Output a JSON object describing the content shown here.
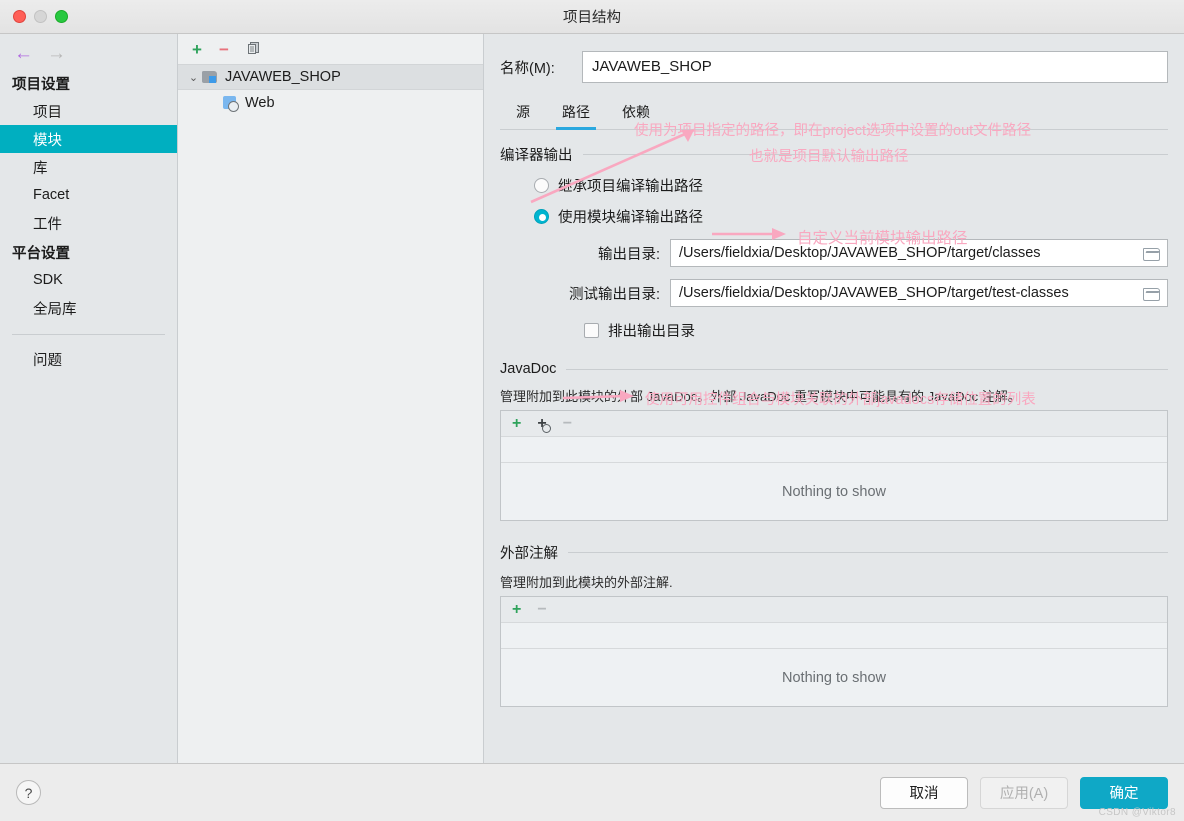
{
  "window": {
    "title": "项目结构",
    "traffic": {
      "close": "close-button",
      "minimize": "minimize-button",
      "zoom": "zoom-button"
    }
  },
  "sidebar": {
    "nav": {
      "back": "←",
      "forward": "→"
    },
    "groups": [
      {
        "title": "项目设置",
        "items": [
          {
            "label": "项目",
            "selected": false
          },
          {
            "label": "模块",
            "selected": true
          },
          {
            "label": "库",
            "selected": false
          },
          {
            "label": "Facet",
            "selected": false
          },
          {
            "label": "工件",
            "selected": false
          }
        ]
      },
      {
        "title": "平台设置",
        "items": [
          {
            "label": "SDK",
            "selected": false
          },
          {
            "label": "全局库",
            "selected": false
          }
        ]
      }
    ],
    "problems": {
      "label": "问题"
    },
    "accent": "#00afc0"
  },
  "tree": {
    "toolbar": {
      "add": "+",
      "remove": "−",
      "copy": "copy-icon"
    },
    "nodes": [
      {
        "label": "JAVAWEB_SHOP",
        "icon": "folder-module-icon",
        "expanded": true,
        "selected": true,
        "chevron": "⌄"
      },
      {
        "label": "Web",
        "icon": "web-facet-icon",
        "expanded": false,
        "selected": false
      }
    ]
  },
  "main": {
    "name_field": {
      "label": "名称(M):",
      "value": "JAVAWEB_SHOP"
    },
    "tabs": [
      {
        "label": "源",
        "active": false
      },
      {
        "label": "路径",
        "active": true
      },
      {
        "label": "依赖",
        "active": false
      }
    ],
    "compiler_output": {
      "title": "编译器输出",
      "radios": [
        {
          "label": "继承项目编译输出路径",
          "checked": false
        },
        {
          "label": "使用模块编译输出路径",
          "checked": true
        }
      ],
      "fields": [
        {
          "label": "输出目录:",
          "value": "/Users/fieldxia/Desktop/JAVAWEB_SHOP/target/classes",
          "browse": "browse-folder-icon"
        },
        {
          "label": "测试输出目录:",
          "value": "/Users/fieldxia/Desktop/JAVAWEB_SHOP/target/test-classes",
          "browse": "browse-folder-icon"
        }
      ],
      "checkbox": {
        "label": "排出输出目录",
        "checked": false
      }
    },
    "javadoc": {
      "title": "JavaDoc",
      "description": "管理附加到此模块的外部 JavaDoc。外部 JavaDoc 重写模块中可能具有的 JavaDoc 注解。",
      "toolbar": {
        "add": "+",
        "add_url": "+",
        "remove": "−"
      },
      "empty": "Nothing to show"
    },
    "external_annotations": {
      "title": "外部注解",
      "description": "管理附加到此模块的外部注解.",
      "toolbar": {
        "add": "+",
        "remove": "−"
      },
      "empty": "Nothing to show"
    }
  },
  "annotations": {
    "color": "#f9a8c0",
    "notes": [
      {
        "id": "note-inherit-path-line1",
        "text": "使用为项目指定的路径，即在project选项中设置的out文件路径"
      },
      {
        "id": "note-inherit-path-line2",
        "text": "也就是项目默认输出路径"
      },
      {
        "id": "note-module-path",
        "text": "自定义当前模块输出路径"
      },
      {
        "id": "note-javadoc",
        "text": "使用可用控件组合与模块关联的外部javadocs存储位置的列表"
      }
    ]
  },
  "footer": {
    "help": "?",
    "buttons": [
      {
        "label": "取消",
        "kind": "default"
      },
      {
        "label": "应用(A)",
        "kind": "disabled"
      },
      {
        "label": "确定",
        "kind": "primary"
      }
    ],
    "watermark": "CSDN @Viktor8"
  }
}
